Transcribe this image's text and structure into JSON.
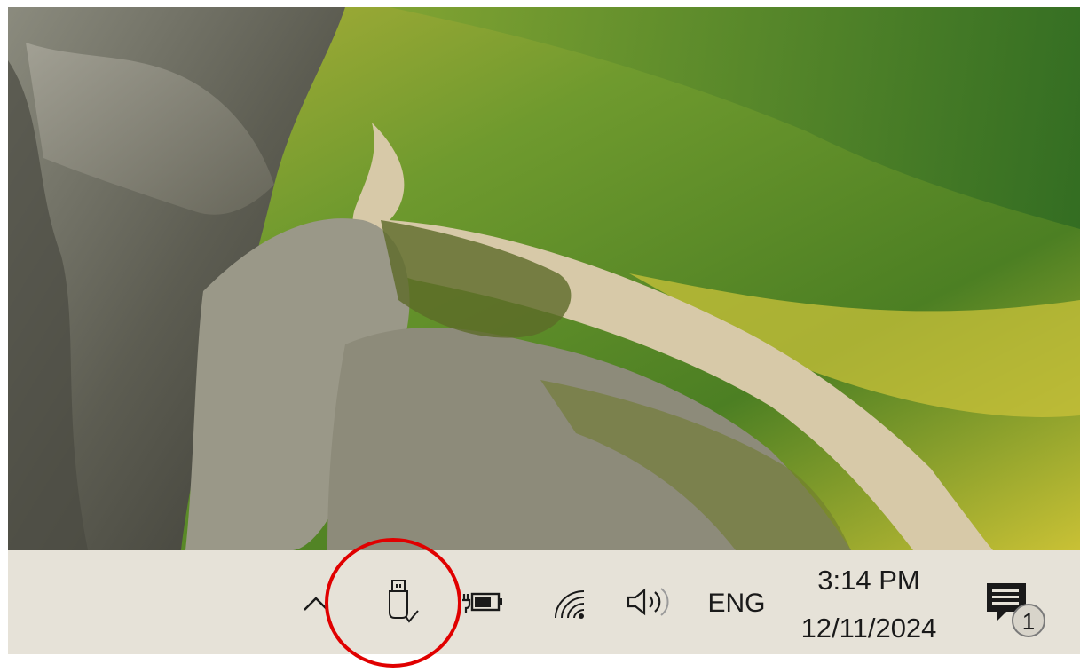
{
  "wallpaper": {
    "description_icon": "landscape-wallpaper"
  },
  "taskbar": {
    "tray": {
      "overflow_icon": "chevron-up-icon",
      "usb_icon": "usb-safely-remove-icon",
      "battery_icon": "battery-charging-icon",
      "wifi_icon": "wifi-icon",
      "volume_icon": "speaker-volume-icon",
      "language": "ENG",
      "time": "3:14 PM",
      "date": "12/11/2024",
      "notification_icon": "action-center-icon",
      "notification_count": "1"
    }
  },
  "colors": {
    "taskbar_bg": "#e6e2d8",
    "highlight": "#e00000",
    "icon": "#1a1a1a"
  }
}
